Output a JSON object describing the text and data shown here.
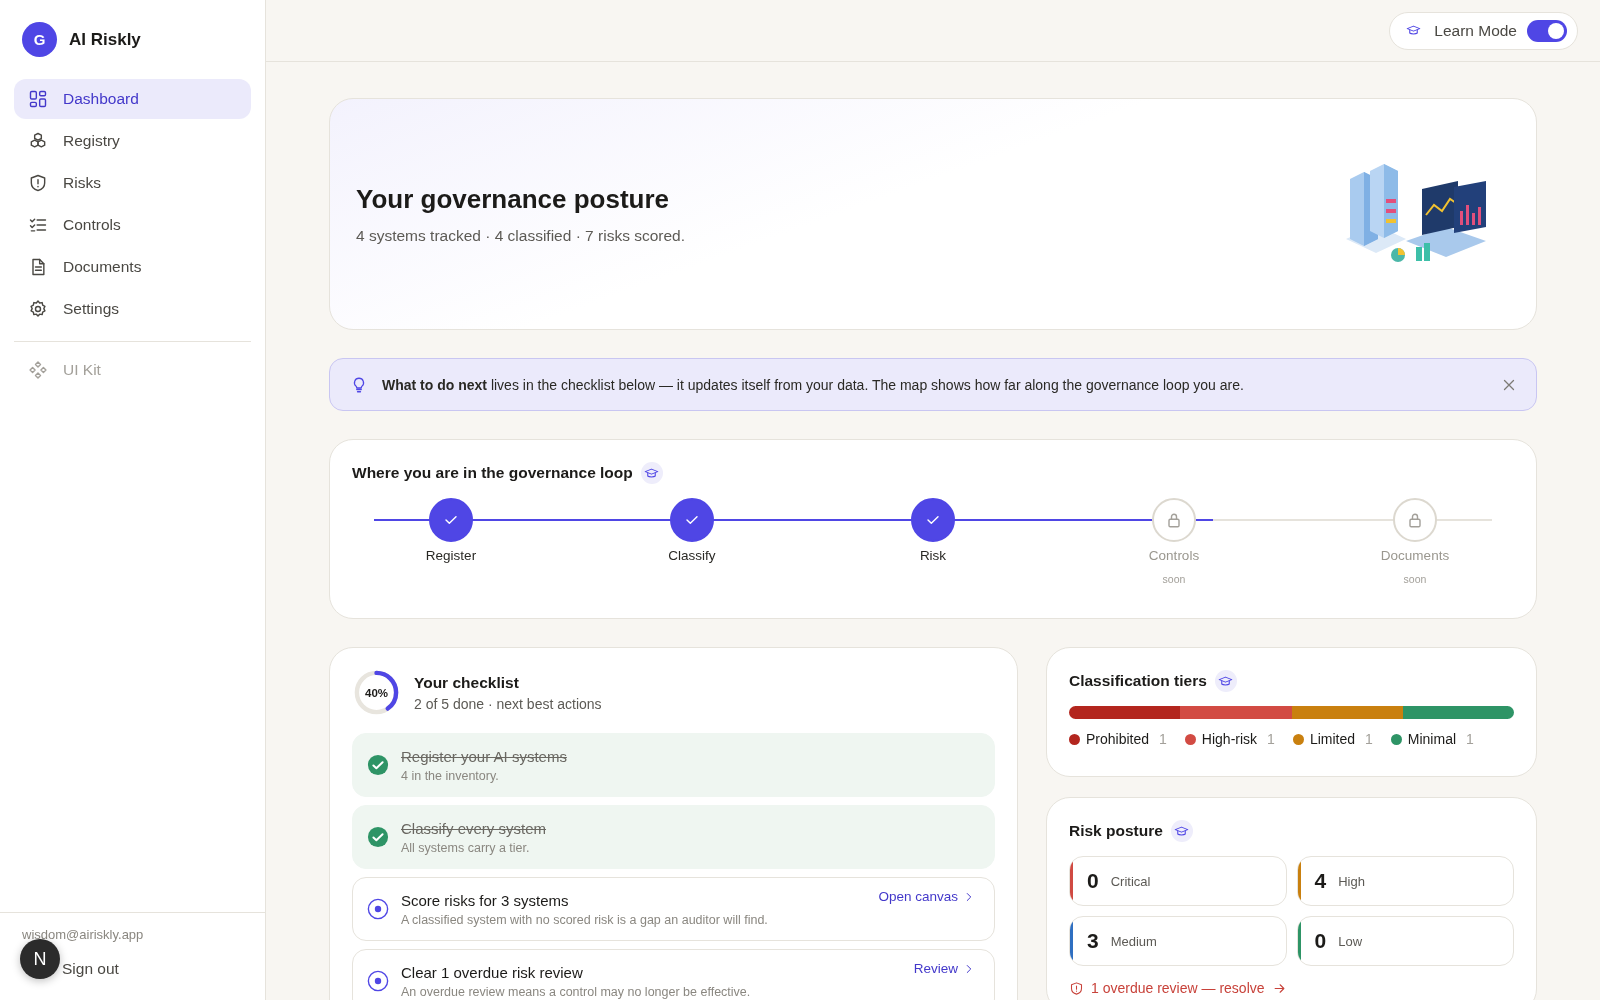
{
  "sidebar": {
    "brand": {
      "initial": "G",
      "name": "AI Riskly"
    },
    "items": [
      {
        "label": "Dashboard",
        "selected": true
      },
      {
        "label": "Registry",
        "selected": false
      },
      {
        "label": "Risks",
        "selected": false
      },
      {
        "label": "Controls",
        "selected": false
      },
      {
        "label": "Documents",
        "selected": false
      },
      {
        "label": "Settings",
        "selected": false
      }
    ],
    "secondary": [
      {
        "label": "UI Kit",
        "disabled": true
      }
    ],
    "account": {
      "email": "wisdom@airiskly.app",
      "sign_out": "Sign out"
    }
  },
  "dev_badge": {
    "label": "N"
  },
  "topbar": {
    "learn_mode": {
      "label": "Learn Mode",
      "on": true
    }
  },
  "hero": {
    "title": "Your governance posture",
    "subtitle": "4 systems tracked · 4 classified · 7 risks scored.",
    "art": {
      "kind": "servers"
    }
  },
  "banner": {
    "text": "**What to do next** lives in the checklist below — it updates itself from your data. The map shows how far along the governance loop you are."
  },
  "loop": {
    "title": "Where you are in the governance loop",
    "level": 0.75,
    "steps": [
      {
        "label": "Register",
        "done": true
      },
      {
        "label": "Classify",
        "done": true
      },
      {
        "label": "Risk",
        "done": true
      },
      {
        "label": "Controls",
        "done": false,
        "note": "soon"
      },
      {
        "label": "Documents",
        "done": false,
        "note": "soon"
      }
    ]
  },
  "checklist": {
    "title": "Your checklist",
    "subtitle": "2 of 5 done · next best actions",
    "percent": "40%",
    "level": 0.4,
    "items": [
      {
        "title": "Register your AI systems",
        "detail": "4 in the inventory.",
        "checked": true
      },
      {
        "title": "Classify every system",
        "detail": "All systems carry a tier.",
        "checked": true
      },
      {
        "title": "Score risks for 3 systems",
        "detail": "A classified system with no scored risk is a gap an auditor will find.",
        "checked": false,
        "action": "Open canvas"
      },
      {
        "title": "Clear 1 overdue risk review",
        "detail": "An overdue review means a control may no longer be effective.",
        "checked": false,
        "action": "Review"
      }
    ]
  },
  "tiers": {
    "title": "Classification tiers",
    "items": [
      {
        "label": "Prohibited",
        "count": "1",
        "color": "#b3261e"
      },
      {
        "label": "High-risk",
        "count": "1",
        "color": "#d24b43"
      },
      {
        "label": "Limited",
        "count": "1",
        "color": "#c9800f"
      },
      {
        "label": "Minimal",
        "count": "1",
        "color": "#2e9466"
      }
    ]
  },
  "posture": {
    "title": "Risk posture",
    "items": [
      {
        "value": "0",
        "label": "Critical",
        "color": "#d04a42"
      },
      {
        "value": "4",
        "label": "High",
        "color": "#c9800f"
      },
      {
        "value": "3",
        "label": "Medium",
        "color": "#2f6fc1"
      },
      {
        "value": "0",
        "label": "Low",
        "color": "#2e9466"
      }
    ],
    "alert": "1 overdue review — resolve"
  }
}
